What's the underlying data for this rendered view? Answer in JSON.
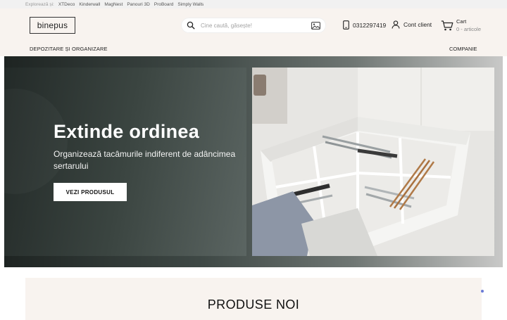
{
  "topbar": {
    "explore_label": "Explorează și:",
    "links": [
      "XTDeco",
      "Kinderwall",
      "MagNest",
      "Panouri 3D",
      "ProBoard",
      "Simply Walls"
    ]
  },
  "header": {
    "logo": "binepus",
    "search": {
      "placeholder": "Cine caută, găsește!",
      "value": ""
    },
    "phone": "0312297419",
    "account_label": "Cont client",
    "cart": {
      "label": "Cart",
      "count": "0 - articole"
    }
  },
  "nav": {
    "left_item": "DEPOZITARE ȘI ORGANIZARE",
    "right_item": "COMPANIE"
  },
  "hero": {
    "title": "Extinde ordinea",
    "subtitle": "Organizează tacâmurile indiferent de adâncimea sertarului",
    "cta_label": "VEZI PRODUSUL"
  },
  "sections": {
    "new_products_title": "PRODUSE NOI"
  },
  "colors": {
    "header_bg": "#f8f3ef",
    "hero_dark": "#2a3230",
    "accent_dot": "#6a7bd6"
  }
}
